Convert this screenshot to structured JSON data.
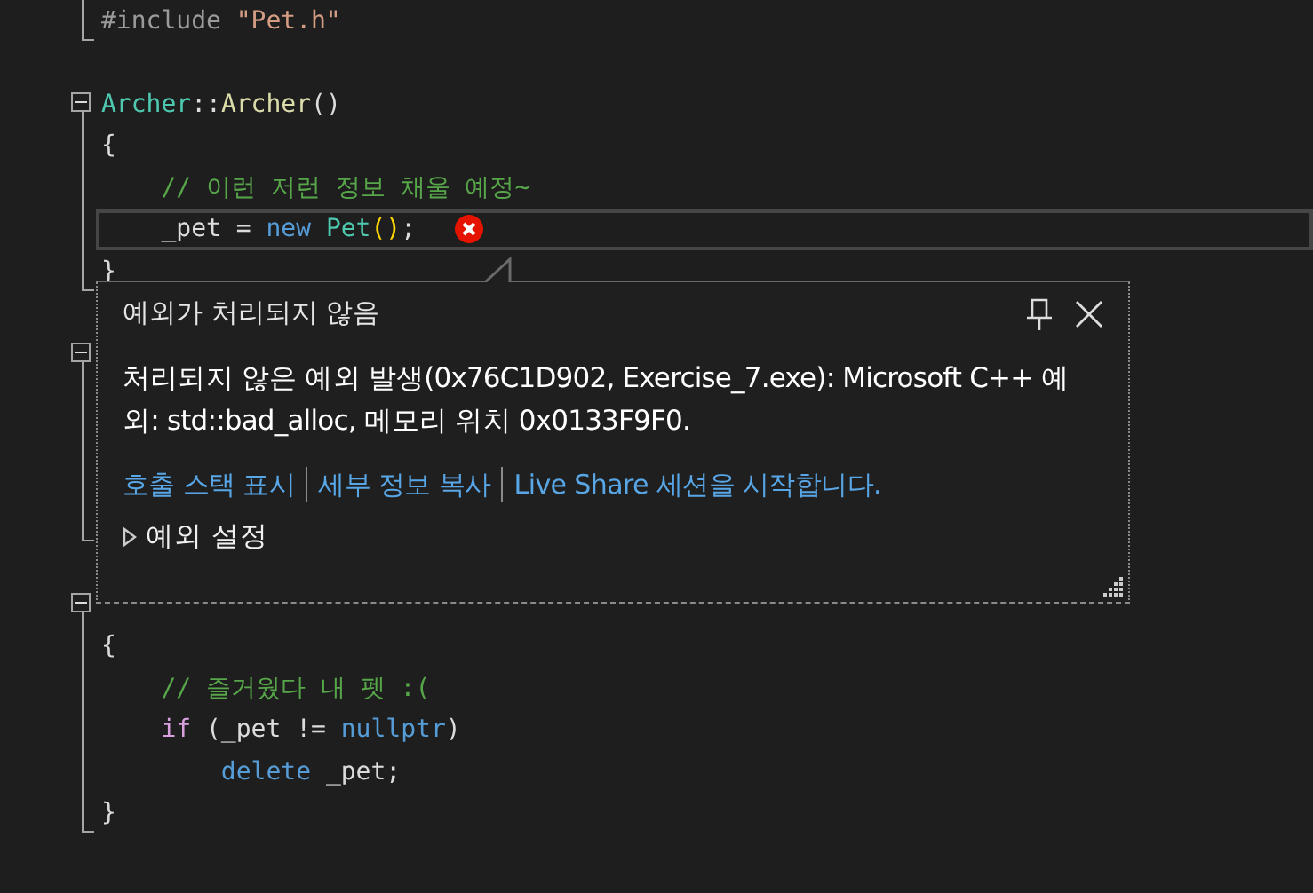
{
  "editor": {
    "lines": [
      {
        "kind": "end",
        "tokens": [
          {
            "kind": "directive",
            "text": "#include "
          },
          {
            "kind": "string",
            "text": "\"Pet.h\""
          }
        ]
      },
      {
        "kind": "blank"
      },
      {
        "kind": "fold",
        "tokens": [
          {
            "kind": "type",
            "text": "Archer"
          },
          {
            "kind": "plain",
            "text": "::"
          },
          {
            "kind": "function",
            "text": "Archer"
          },
          {
            "kind": "plain",
            "text": "()"
          }
        ]
      },
      {
        "kind": "body",
        "tokens": [
          {
            "kind": "plain",
            "text": "{"
          }
        ]
      },
      {
        "kind": "body",
        "tokens": [
          {
            "kind": "comment",
            "text": "    // 이런 저런 정보 채울 예정~"
          }
        ]
      },
      {
        "kind": "body",
        "current": true,
        "error": true,
        "tokens": [
          {
            "kind": "plain",
            "text": "    _pet = "
          },
          {
            "kind": "keyword",
            "text": "new "
          },
          {
            "kind": "type",
            "text": "Pet"
          },
          {
            "kind": "paren",
            "text": "()"
          },
          {
            "kind": "plain",
            "text": ";"
          }
        ]
      },
      {
        "kind": "end",
        "tokens": [
          {
            "kind": "plain",
            "text": "}"
          }
        ]
      },
      {
        "kind": "blank"
      },
      {
        "kind": "fold"
      },
      {
        "kind": "body"
      },
      {
        "kind": "body"
      },
      {
        "kind": "body"
      },
      {
        "kind": "end"
      },
      {
        "kind": "blank"
      },
      {
        "kind": "fold"
      },
      {
        "kind": "body",
        "tokens": [
          {
            "kind": "plain",
            "text": "{"
          }
        ]
      },
      {
        "kind": "body",
        "tokens": [
          {
            "kind": "comment",
            "text": "    // 즐거웠다 내 펫 :("
          }
        ]
      },
      {
        "kind": "body",
        "tokens": [
          {
            "kind": "control",
            "text": "    if"
          },
          {
            "kind": "plain",
            "text": " (_pet != "
          },
          {
            "kind": "keyword",
            "text": "nullptr"
          },
          {
            "kind": "plain",
            "text": ")"
          }
        ]
      },
      {
        "kind": "body",
        "tokens": [
          {
            "kind": "keyword",
            "text": "        delete"
          },
          {
            "kind": "plain",
            "text": " _pet;"
          }
        ]
      },
      {
        "kind": "end",
        "tokens": [
          {
            "kind": "plain",
            "text": "}"
          }
        ]
      }
    ]
  },
  "exception_popup": {
    "title": "예외가 처리되지 않음",
    "message": "처리되지 않은 예외 발생(0x76C1D902, Exercise_7.exe): Microsoft C++ 예외: std::bad_alloc, 메모리 위치 0x0133F9F0.",
    "links": [
      "호출 스택 표시",
      "세부 정보 복사",
      "Live Share 세션을 시작합니다."
    ],
    "settings": {
      "label": "예외 설정",
      "expanded": false
    }
  }
}
